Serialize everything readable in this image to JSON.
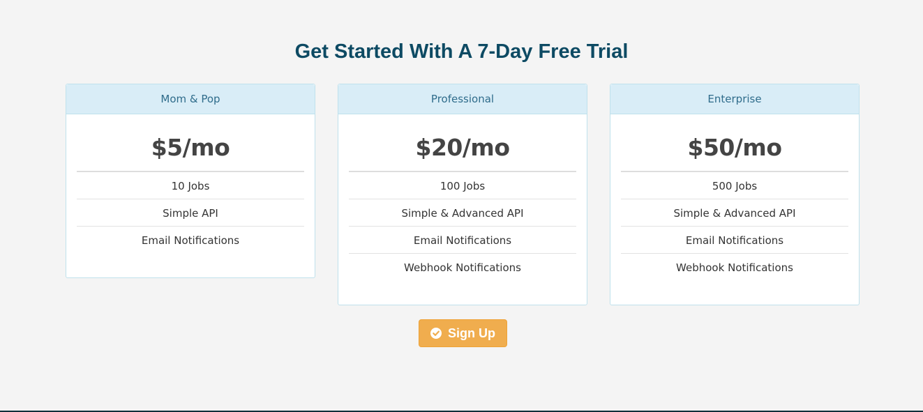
{
  "heading": "Get Started With A 7-Day Free Trial",
  "plans": [
    {
      "name": "Mom & Pop",
      "price": "$5/mo",
      "features": [
        "10 Jobs",
        "Simple API",
        "Email Notifications"
      ]
    },
    {
      "name": "Professional",
      "price": "$20/mo",
      "features": [
        "100 Jobs",
        "Simple & Advanced API",
        "Email Notifications",
        "Webhook Notifications"
      ]
    },
    {
      "name": "Enterprise",
      "price": "$50/mo",
      "features": [
        "500 Jobs",
        "Simple & Advanced API",
        "Email Notifications",
        "Webhook Notifications"
      ]
    }
  ],
  "signup": {
    "label": "Sign Up",
    "icon": "check-circle-icon"
  },
  "colors": {
    "heading": "#0d4a63",
    "card_header_bg": "#d9edf7",
    "button": "#f0ad4e"
  }
}
